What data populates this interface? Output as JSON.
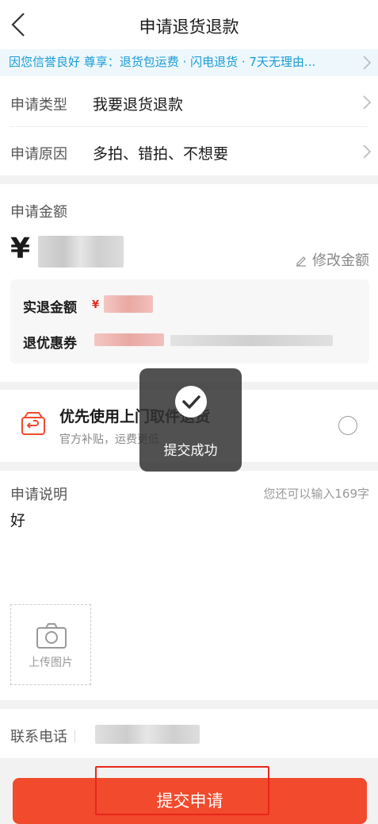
{
  "header": {
    "title": "申请退货退款"
  },
  "banner": {
    "text": "因您信誉良好 尊享：退货包运费 · 闪电退货 · 7天无理由..."
  },
  "request_type": {
    "label": "申请类型",
    "value": "我要退货退款"
  },
  "request_reason": {
    "label": "申请原因",
    "value": "多拍、错拍、不想要"
  },
  "amount": {
    "label": "申请金额",
    "currency": "¥",
    "edit_label": "修改金额",
    "actual_label": "实退金额",
    "actual_currency": "¥",
    "coupon_label": "退优惠券"
  },
  "pickup": {
    "title": "优先使用上门取件退货",
    "subtitle": "官方补贴，运费更低"
  },
  "toast": {
    "text": "提交成功"
  },
  "description": {
    "label": "申请说明",
    "counter": "您还可以输入169字",
    "value": "好"
  },
  "upload": {
    "label": "上传图片"
  },
  "phone": {
    "label": "联系电话"
  },
  "submit": {
    "label": "提交申请"
  },
  "colors": {
    "accent": "#f24a2c",
    "banner_text": "#1a9bd7",
    "price": "#e8261d"
  }
}
